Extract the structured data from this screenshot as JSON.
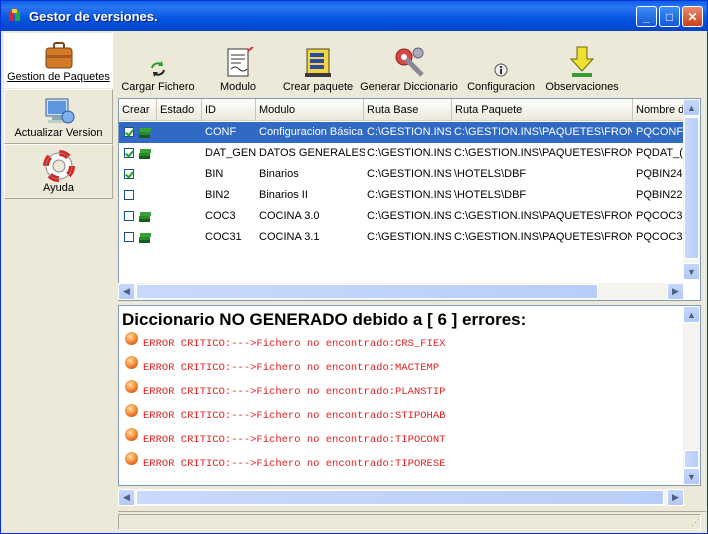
{
  "window": {
    "title": "Gestor de versiones."
  },
  "nav": {
    "items": [
      {
        "label": "Gestion de Paquetes",
        "icon": "briefcase-icon",
        "active": true
      },
      {
        "label": "Actualizar Version",
        "icon": "computer-update-icon",
        "active": false
      },
      {
        "label": "Ayuda",
        "icon": "lifebuoy-icon",
        "active": false
      }
    ]
  },
  "toolbar": {
    "buttons": [
      {
        "label": "Cargar Fichero",
        "icon": "refresh-arrows-icon"
      },
      {
        "label": "Modulo",
        "icon": "document-icon"
      },
      {
        "label": "Crear paquete",
        "icon": "package-zip-icon"
      },
      {
        "label": "Generar Diccionario",
        "icon": "wrench-gear-icon"
      },
      {
        "label": "Configuracion",
        "icon": "info-icon"
      },
      {
        "label": "Observaciones",
        "icon": "download-arrow-icon"
      }
    ]
  },
  "grid": {
    "columns": [
      "Crear",
      "Estado",
      "ID",
      "Modulo",
      "Ruta Base",
      "Ruta Paquete",
      "Nombre d"
    ],
    "rows": [
      {
        "checked": true,
        "books": true,
        "id": "CONF",
        "modulo": "Configuracion Básica",
        "ruta_base": "C:\\GESTION.INS",
        "ruta_paquete": "C:\\GESTION.INS\\PAQUETES\\FRONT",
        "nombre": "PQCONF",
        "selected": true
      },
      {
        "checked": true,
        "books": true,
        "id": "DAT_GEN",
        "modulo": "DATOS GENERALES",
        "ruta_base": "C:\\GESTION.INS",
        "ruta_paquete": "C:\\GESTION.INS\\PAQUETES\\FRONT",
        "nombre": "PQDAT_(",
        "selected": false
      },
      {
        "checked": true,
        "books": false,
        "id": "BIN",
        "modulo": "Binarios",
        "ruta_base": "C:\\GESTION.INS",
        "ruta_paquete": "\\HOTELS\\DBF",
        "nombre": "PQBIN24",
        "selected": false
      },
      {
        "checked": false,
        "books": false,
        "id": "BIN2",
        "modulo": "Binarios II",
        "ruta_base": "C:\\GESTION.INS",
        "ruta_paquete": "\\HOTELS\\DBF",
        "nombre": "PQBIN22",
        "selected": false
      },
      {
        "checked": false,
        "books": true,
        "id": "COC3",
        "modulo": "COCINA 3.0",
        "ruta_base": "C:\\GESTION.INS",
        "ruta_paquete": "C:\\GESTION.INS\\PAQUETES\\FRONT",
        "nombre": "PQCOC3",
        "selected": false
      },
      {
        "checked": false,
        "books": true,
        "id": "COC31",
        "modulo": "COCINA 3.1",
        "ruta_base": "C:\\GESTION.INS",
        "ruta_paquete": "C:\\GESTION.INS\\PAQUETES\\FRONT",
        "nombre": "PQCOC3",
        "selected": false
      }
    ]
  },
  "errors": {
    "title": "Diccionario NO GENERADO debido a [ 6 ] errores:",
    "lines": [
      "ERROR CRITICO:--->Fichero no encontrado:CRS_FIEX",
      "ERROR CRITICO:--->Fichero no encontrado:MACTEMP",
      "ERROR CRITICO:--->Fichero no encontrado:PLANSTIP",
      "ERROR CRITICO:--->Fichero no encontrado:STIPOHAB",
      "ERROR CRITICO:--->Fichero no encontrado:TIPOCONT",
      "ERROR CRITICO:--->Fichero no encontrado:TIPORESE"
    ]
  },
  "colors": {
    "titlebar": "#0454e0",
    "selection": "#316ac5",
    "error_text": "#e02020",
    "face": "#ece9d8"
  }
}
